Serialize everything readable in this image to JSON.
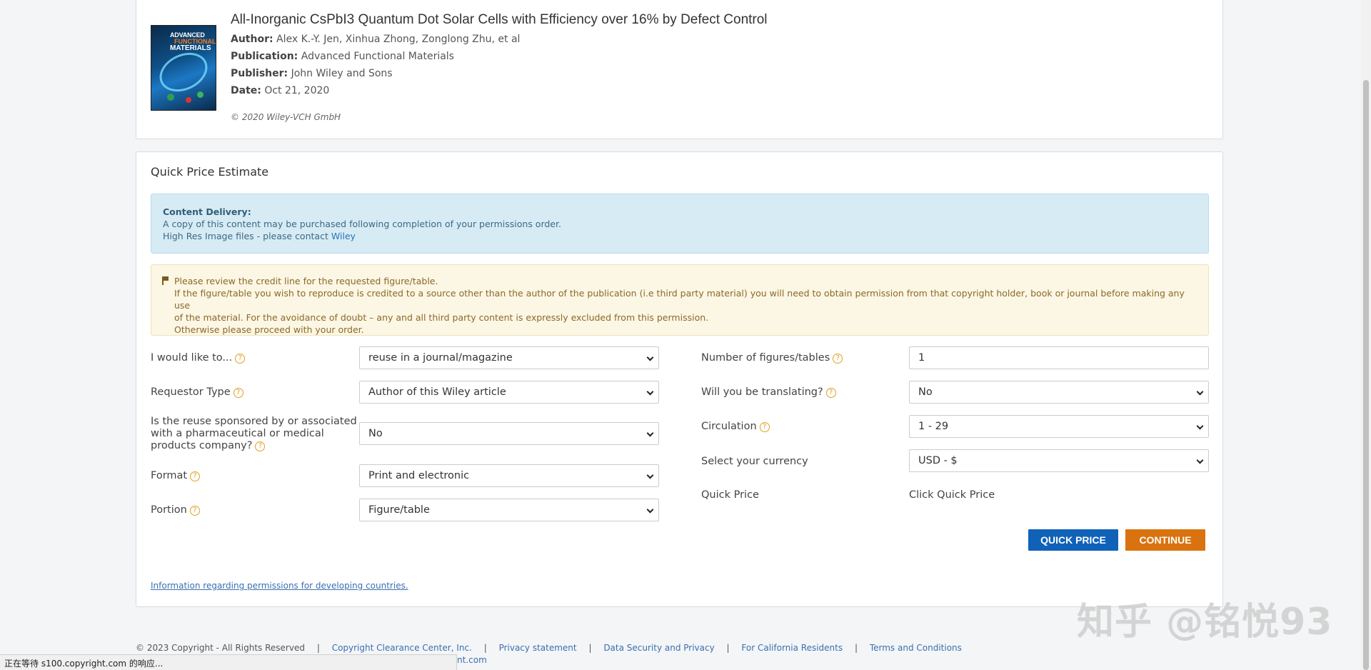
{
  "article": {
    "title": "All-Inorganic CsPbI3 Quantum Dot Solar Cells with Efficiency over 16% by Defect Control",
    "author_label": "Author:",
    "author": "Alex K.-Y. Jen, Xinhua Zhong, Zonglong Zhu, et al",
    "publication_label": "Publication:",
    "publication": "Advanced Functional Materials",
    "publisher_label": "Publisher:",
    "publisher": "John Wiley and Sons",
    "date_label": "Date:",
    "date": "Oct 21, 2020",
    "copyright": "© 2020 Wiley‐VCH GmbH",
    "cover": {
      "line1": "ADVANCED",
      "line2": "FUNCTIONAL",
      "line3": "MATERIALS"
    }
  },
  "quick_price": {
    "title": "Quick Price Estimate",
    "content_delivery": {
      "heading": "Content Delivery:",
      "line1": "A copy of this content may be purchased following completion of your permissions order.",
      "line2": "High Res Image files - please contact",
      "link": "Wiley"
    },
    "notice": {
      "line1": "Please review the credit line for the requested figure/table.",
      "line2": "If the figure/table you wish to reproduce is credited to a source other than the author of the publication (i.e third party material) you will need to obtain permission from that copyright holder, book or journal before making any use",
      "line3": "of the material. For the avoidance of doubt – any and all third party content is expressly excluded from this permission.",
      "line4": "Otherwise please proceed with your order."
    },
    "left_fields": {
      "would_like_label": "I would like to...",
      "would_like_value": "reuse in a journal/magazine",
      "requestor_label": "Requestor Type",
      "requestor_value": "Author of this Wiley article",
      "sponsored_label_1": "Is the reuse sponsored by or associated",
      "sponsored_label_2": "with a pharmaceutical or medical",
      "sponsored_label_3": "products company?",
      "sponsored_value": "No",
      "format_label": "Format",
      "format_value": "Print and electronic",
      "portion_label": "Portion",
      "portion_value": "Figure/table"
    },
    "right_fields": {
      "num_figures_label": "Number of figures/tables",
      "num_figures_value": "1",
      "translating_label": "Will you be translating?",
      "translating_value": "No",
      "circulation_label": "Circulation",
      "circulation_value": "1 - 29",
      "currency_label": "Select your currency",
      "currency_value": "USD - $",
      "quick_price_label": "Quick Price",
      "quick_price_value": "Click Quick Price"
    },
    "help_glyph": "?",
    "buttons": {
      "quick_price": "QUICK PRICE",
      "continue": "CONTINUE"
    },
    "developing_link": "Information regarding permissions for developing countries."
  },
  "footer": {
    "copyright": "© 2023 Copyright - All Rights Reserved",
    "links": [
      "Copyright Clearance Center, Inc.",
      "Privacy statement",
      "Data Security and Privacy",
      "For California Residents",
      "Terms and Conditions"
    ],
    "line2_fragment": "nt.com"
  },
  "status_bar": "正在等待 s100.copyright.com 的响应...",
  "watermark": "知乎 @铭悦93",
  "colors": {
    "quick_price_button": "#0f62b8",
    "continue_button": "#d9730f",
    "info_bg": "#d7ebf5",
    "notice_bg": "#fcf6e4"
  }
}
